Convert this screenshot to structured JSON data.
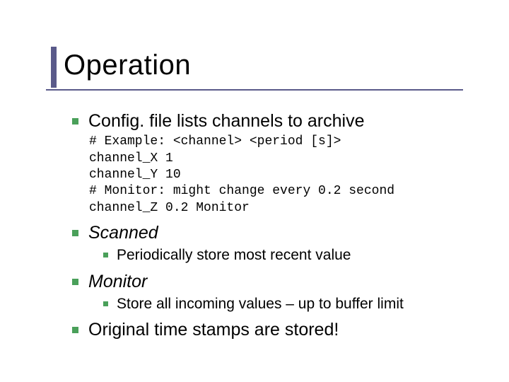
{
  "title": "Operation",
  "items": [
    {
      "text": "Config. file lists channels to archive",
      "code": "# Example: <channel> <period [s]>\nchannel_X 1\nchannel_Y 10\n# Monitor: might change every 0.2 second\nchannel_Z 0.2 Monitor"
    },
    {
      "text": "Scanned",
      "italic": true,
      "sub": "Periodically store most recent value"
    },
    {
      "text": "Monitor",
      "italic": true,
      "sub": "Store all incoming values – up to buffer limit"
    },
    {
      "text": "Original time stamps are stored!"
    }
  ]
}
